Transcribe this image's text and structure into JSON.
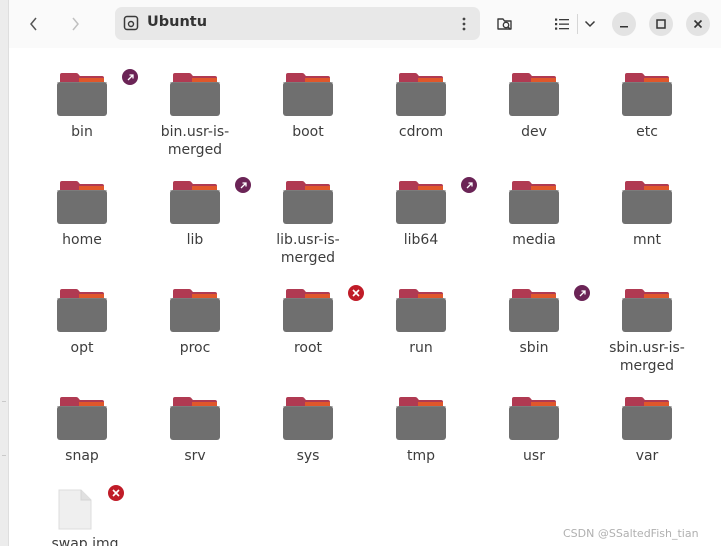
{
  "window": {
    "location": "Ubuntu",
    "buttons": {
      "back": "back",
      "forward": "forward",
      "location_menu": "location-menu",
      "search": "search",
      "view": "list-view",
      "view_options": "view-options",
      "minimize": "minimize",
      "maximize": "maximize",
      "close": "close"
    }
  },
  "items": [
    {
      "name": "bin",
      "emblem": "link"
    },
    {
      "name": "bin.usr-is-merged",
      "emblem": ""
    },
    {
      "name": "boot",
      "emblem": ""
    },
    {
      "name": "cdrom",
      "emblem": ""
    },
    {
      "name": "dev",
      "emblem": ""
    },
    {
      "name": "etc",
      "emblem": ""
    },
    {
      "name": "home",
      "emblem": ""
    },
    {
      "name": "lib",
      "emblem": "link"
    },
    {
      "name": "lib.usr-is-merged",
      "emblem": ""
    },
    {
      "name": "lib64",
      "emblem": "link"
    },
    {
      "name": "media",
      "emblem": ""
    },
    {
      "name": "mnt",
      "emblem": ""
    },
    {
      "name": "opt",
      "emblem": ""
    },
    {
      "name": "proc",
      "emblem": ""
    },
    {
      "name": "root",
      "emblem": "noperm"
    },
    {
      "name": "run",
      "emblem": ""
    },
    {
      "name": "sbin",
      "emblem": "link"
    },
    {
      "name": "sbin.usr-is-merged",
      "emblem": ""
    },
    {
      "name": "snap",
      "emblem": ""
    },
    {
      "name": "srv",
      "emblem": ""
    },
    {
      "name": "sys",
      "emblem": ""
    },
    {
      "name": "tmp",
      "emblem": ""
    },
    {
      "name": "usr",
      "emblem": ""
    },
    {
      "name": "var",
      "emblem": ""
    }
  ],
  "file": {
    "name": "swap.img",
    "emblem": "noperm"
  },
  "watermark": "CSDN @SSaltedFish_tian",
  "colors": {
    "folder_body": "#6f6f6f",
    "folder_tab": "#b03a52",
    "folder_stripe": "#e0572b",
    "emblem_link": "#6b2456",
    "emblem_noperm": "#c01c28"
  }
}
